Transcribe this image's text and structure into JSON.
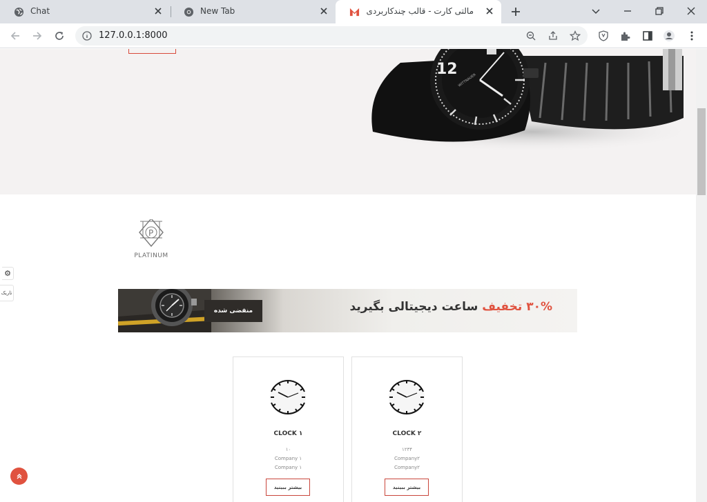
{
  "browser": {
    "tabs": [
      {
        "title": "Chat",
        "icon": "globe-icon"
      },
      {
        "title": "New Tab",
        "icon": "chrome-icon"
      },
      {
        "title": "مالتی کارت - قالب چندکاربردی",
        "icon": "m-logo-icon",
        "active": true
      }
    ],
    "url": "127.0.0.1:8000"
  },
  "page": {
    "brand_name": "PLATINUM",
    "side_dark_label": "تاریک",
    "banner": {
      "cta": "منقضی شده",
      "headline_accent": "۳۰% تخفیف",
      "headline_rest": "ساعت دیجیتالی بگیرید"
    },
    "products": [
      {
        "name": "CLOCK ۱",
        "price": "۱۰",
        "company_a": "Company ۱",
        "company_b": "Company ۱",
        "button": "بیشتر ببینید"
      },
      {
        "name": "CLOCK ۲",
        "price": "۱۲۳۴",
        "company_a": "Company۲",
        "company_b": "Company۲",
        "button": "بیشتر ببینید"
      }
    ]
  },
  "colors": {
    "accent": "#e0523f",
    "tab_bar": "#dee1e6",
    "hero_bg": "#f4f2f2"
  }
}
